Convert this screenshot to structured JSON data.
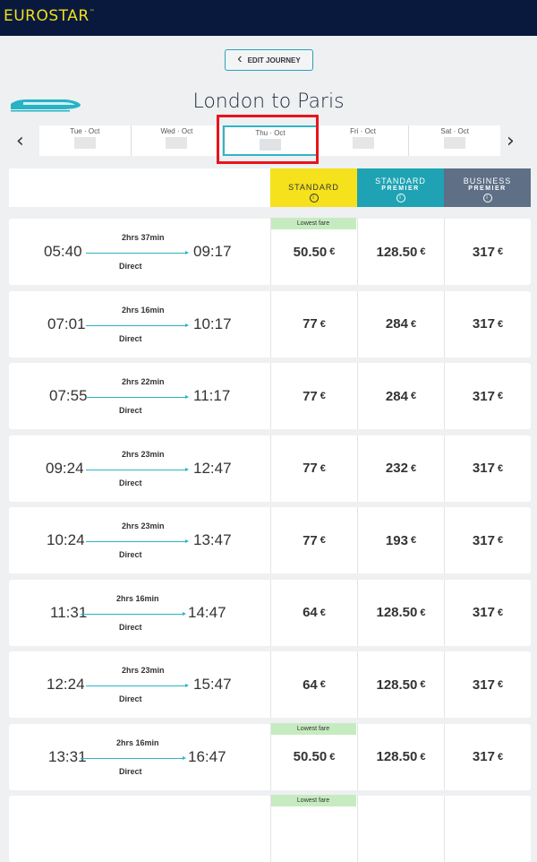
{
  "header": {
    "logo": "EUROSTAR",
    "logo_tm": "™"
  },
  "edit_journey": "EDIT JOURNEY",
  "route_title": "London to Paris",
  "dates": [
    {
      "label": "Tue · Oct",
      "active": false
    },
    {
      "label": "Wed · Oct",
      "active": false
    },
    {
      "label": "Thu · Oct",
      "active": true
    },
    {
      "label": "Fri · Oct",
      "active": false
    },
    {
      "label": "Sat · Oct",
      "active": false
    }
  ],
  "fare_headers": {
    "standard": "STANDARD",
    "standard_premier_l1": "STANDARD",
    "standard_premier_l2": "PREMIER",
    "business_premier_l1": "BUSINESS",
    "business_premier_l2": "PREMIER",
    "info": "i"
  },
  "currency": "€",
  "journey_type": "Direct",
  "lowest_fare_label": "Lowest fare",
  "trains": [
    {
      "dep": "05:40",
      "arr": "09:17",
      "duration": "2hrs 37min",
      "standard": "50.50",
      "standard_premier": "128.50",
      "business_premier": "317",
      "lowest": true
    },
    {
      "dep": "07:01",
      "arr": "10:17",
      "duration": "2hrs 16min",
      "standard": "77",
      "standard_premier": "284",
      "business_premier": "317",
      "lowest": false
    },
    {
      "dep": "07:55",
      "arr": "11:17",
      "duration": "2hrs 22min",
      "standard": "77",
      "standard_premier": "284",
      "business_premier": "317",
      "lowest": false
    },
    {
      "dep": "09:24",
      "arr": "12:47",
      "duration": "2hrs 23min",
      "standard": "77",
      "standard_premier": "232",
      "business_premier": "317",
      "lowest": false
    },
    {
      "dep": "10:24",
      "arr": "13:47",
      "duration": "2hrs 23min",
      "standard": "77",
      "standard_premier": "193",
      "business_premier": "317",
      "lowest": false
    },
    {
      "dep": "11:31",
      "arr": "14:47",
      "duration": "2hrs 16min",
      "standard": "64",
      "standard_premier": "128.50",
      "business_premier": "317",
      "lowest": false
    },
    {
      "dep": "12:24",
      "arr": "15:47",
      "duration": "2hrs 23min",
      "standard": "64",
      "standard_premier": "128.50",
      "business_premier": "317",
      "lowest": false
    },
    {
      "dep": "13:31",
      "arr": "16:47",
      "duration": "2hrs 16min",
      "standard": "50.50",
      "standard_premier": "128.50",
      "business_premier": "317",
      "lowest": true
    },
    {
      "dep": "",
      "arr": "",
      "duration": "",
      "standard": "",
      "standard_premier": "",
      "business_premier": "",
      "lowest": true
    }
  ]
}
